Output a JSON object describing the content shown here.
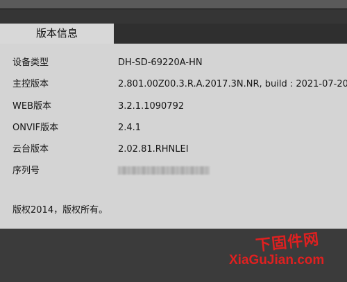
{
  "tab": {
    "label": "版本信息"
  },
  "info": {
    "rows": [
      {
        "label": "设备类型",
        "value": "DH-SD-69220A-HN"
      },
      {
        "label": "主控版本",
        "value": "2.801.00Z00.3.R.A.2017.3N.NR, build : 2021-07-20"
      },
      {
        "label": "WEB版本",
        "value": "3.2.1.1090792"
      },
      {
        "label": "ONVIF版本",
        "value": "2.4.1"
      },
      {
        "label": "云台版本",
        "value": "2.02.81.RHNLEI"
      },
      {
        "label": "序列号",
        "value": ""
      }
    ]
  },
  "copyright": "版权2014，版权所有。",
  "watermark": {
    "cn": "下固件网",
    "en": "XiaGuJian.com",
    "color": "#e02020"
  }
}
